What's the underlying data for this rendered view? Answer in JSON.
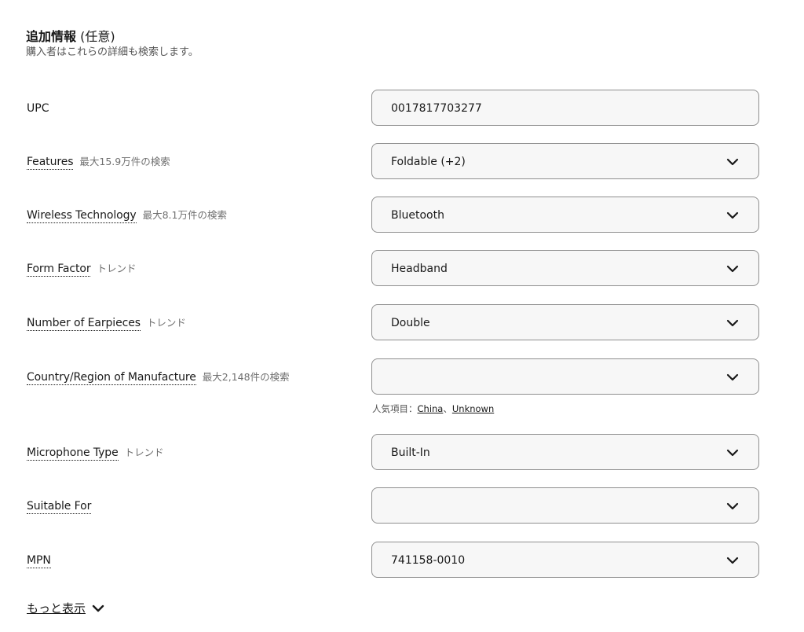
{
  "section": {
    "title": "追加情報",
    "optional": "(任意)",
    "subtitle": "購入者はこれらの詳細も検索します。"
  },
  "fields": [
    {
      "label": "UPC",
      "hint": "",
      "value": "0017817703277",
      "type": "text"
    },
    {
      "label": "Features",
      "hint": "最大15.9万件の検索",
      "value": "Foldable (+2)",
      "type": "select"
    },
    {
      "label": "Wireless Technology",
      "hint": "最大8.1万件の検索",
      "value": "Bluetooth",
      "type": "select"
    },
    {
      "label": "Form Factor",
      "hint": "トレンド",
      "value": "Headband",
      "type": "select"
    },
    {
      "label": "Number of Earpieces",
      "hint": "トレンド",
      "value": "Double",
      "type": "select"
    },
    {
      "label": "Country/Region of Manufacture",
      "hint": "最大2,148件の検索",
      "value": "",
      "type": "select"
    },
    {
      "label": "Microphone Type",
      "hint": "トレンド",
      "value": "Built-In",
      "type": "select"
    },
    {
      "label": "Suitable For",
      "hint": "",
      "value": "",
      "type": "select"
    },
    {
      "label": "MPN",
      "hint": "",
      "value": "741158-0010",
      "type": "select"
    }
  ],
  "popular": {
    "prefix": "人気項目：",
    "items": [
      "China",
      "Unknown"
    ],
    "separator": "、"
  },
  "show_more": {
    "label": "もっと表示",
    "icon": "chevron-down-icon"
  }
}
